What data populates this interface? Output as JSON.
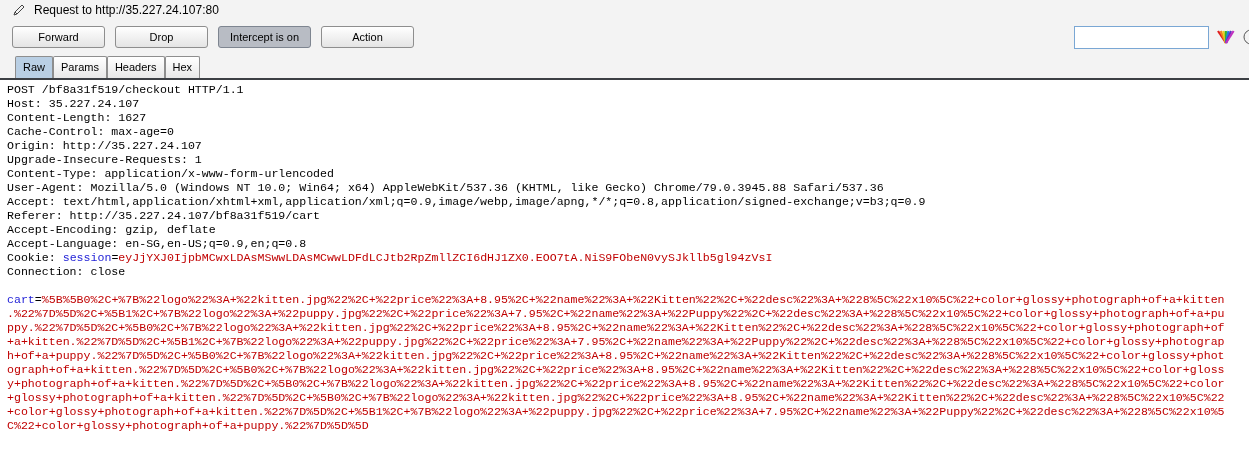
{
  "title": "Request to http://35.227.24.107:80",
  "buttons": [
    {
      "label": "Forward",
      "pressed": false
    },
    {
      "label": "Drop",
      "pressed": false
    },
    {
      "label": "Intercept is on",
      "pressed": true
    },
    {
      "label": "Action",
      "pressed": false
    }
  ],
  "tabs": [
    {
      "label": "Raw",
      "selected": true
    },
    {
      "label": "Params",
      "selected": false
    },
    {
      "label": "Headers",
      "selected": false
    },
    {
      "label": "Hex",
      "selected": false
    }
  ],
  "headers": [
    {
      "kind": "plain",
      "text": "POST /bf8a31f519/checkout HTTP/1.1"
    },
    {
      "kind": "plain",
      "text": "Host: 35.227.24.107"
    },
    {
      "kind": "plain",
      "text": "Content-Length: 1627"
    },
    {
      "kind": "plain",
      "text": "Cache-Control: max-age=0"
    },
    {
      "kind": "plain",
      "text": "Origin: http://35.227.24.107"
    },
    {
      "kind": "plain",
      "text": "Upgrade-Insecure-Requests: 1"
    },
    {
      "kind": "plain",
      "text": "Content-Type: application/x-www-form-urlencoded"
    },
    {
      "kind": "plain",
      "text": "User-Agent: Mozilla/5.0 (Windows NT 10.0; Win64; x64) AppleWebKit/537.36 (KHTML, like Gecko) Chrome/79.0.3945.88 Safari/537.36"
    },
    {
      "kind": "plain",
      "text": "Accept: text/html,application/xhtml+xml,application/xml;q=0.9,image/webp,image/apng,*/*;q=0.8,application/signed-exchange;v=b3;q=0.9"
    },
    {
      "kind": "plain",
      "text": "Referer: http://35.227.24.107/bf8a31f519/cart"
    },
    {
      "kind": "plain",
      "text": "Accept-Encoding: gzip, deflate"
    },
    {
      "kind": "plain",
      "text": "Accept-Language: en-SG,en-US;q=0.9,en;q=0.8"
    },
    {
      "kind": "cookie",
      "prefix": "Cookie: ",
      "name": "session",
      "separator": "=",
      "value": "eyJjYXJ0IjpbMCwxLDAsMSwwLDAsMCwwLDFdLCJtb2RpZmllZCI6dHJ1ZX0.EOO7tA.NiS9FObeN0vySJkllb5gl94zVsI"
    },
    {
      "kind": "plain",
      "text": "Connection: close"
    }
  ],
  "body": [
    {
      "kind": "param",
      "name": "cart",
      "separator": "=",
      "value": "%5B%5B0%2C+%7B%22logo%22%3A+%22kitten.jpg%22%2C+%22price%22%3A+8.95%2C+%22name%22%3A+%22Kitten%22%2C+%22desc%22%3A+%228%5C%22x10%5C%22+color+glossy+photograph+of+a+kitten"
    },
    {
      "kind": "value",
      "text": ".%22%7D%5D%2C+%5B1%2C+%7B%22logo%22%3A+%22puppy.jpg%22%2C+%22price%22%3A+7.95%2C+%22name%22%3A+%22Puppy%22%2C+%22desc%22%3A+%228%5C%22x10%5C%22+color+glossy+photograph+of+a+pu"
    },
    {
      "kind": "value",
      "text": "ppy.%22%7D%5D%2C+%5B0%2C+%7B%22logo%22%3A+%22kitten.jpg%22%2C+%22price%22%3A+8.95%2C+%22name%22%3A+%22Kitten%22%2C+%22desc%22%3A+%228%5C%22x10%5C%22+color+glossy+photograph+of"
    },
    {
      "kind": "value",
      "text": "+a+kitten.%22%7D%5D%2C+%5B1%2C+%7B%22logo%22%3A+%22puppy.jpg%22%2C+%22price%22%3A+7.95%2C+%22name%22%3A+%22Puppy%22%2C+%22desc%22%3A+%228%5C%22x10%5C%22+color+glossy+photograp"
    },
    {
      "kind": "value",
      "text": "h+of+a+puppy.%22%7D%5D%2C+%5B0%2C+%7B%22logo%22%3A+%22kitten.jpg%22%2C+%22price%22%3A+8.95%2C+%22name%22%3A+%22Kitten%22%2C+%22desc%22%3A+%228%5C%22x10%5C%22+color+glossy+phot"
    },
    {
      "kind": "value",
      "text": "ograph+of+a+kitten.%22%7D%5D%2C+%5B0%2C+%7B%22logo%22%3A+%22kitten.jpg%22%2C+%22price%22%3A+8.95%2C+%22name%22%3A+%22Kitten%22%2C+%22desc%22%3A+%228%5C%22x10%5C%22+color+gloss"
    },
    {
      "kind": "value",
      "text": "y+photograph+of+a+kitten.%22%7D%5D%2C+%5B0%2C+%7B%22logo%22%3A+%22kitten.jpg%22%2C+%22price%22%3A+8.95%2C+%22name%22%3A+%22Kitten%22%2C+%22desc%22%3A+%228%5C%22x10%5C%22+color"
    },
    {
      "kind": "value",
      "text": "+glossy+photograph+of+a+kitten.%22%7D%5D%2C+%5B0%2C+%7B%22logo%22%3A+%22kitten.jpg%22%2C+%22price%22%3A+8.95%2C+%22name%22%3A+%22Kitten%22%2C+%22desc%22%3A+%228%5C%22x10%5C%22"
    },
    {
      "kind": "value",
      "text": "+color+glossy+photograph+of+a+kitten.%22%7D%5D%2C+%5B1%2C+%7B%22logo%22%3A+%22puppy.jpg%22%2C+%22price%22%3A+7.95%2C+%22name%22%3A+%22Puppy%22%2C+%22desc%22%3A+%228%5C%22x10%5"
    },
    {
      "kind": "value",
      "text": "C%22+color+glossy+photograph+of+a+puppy.%22%7D%5D%5D"
    }
  ]
}
